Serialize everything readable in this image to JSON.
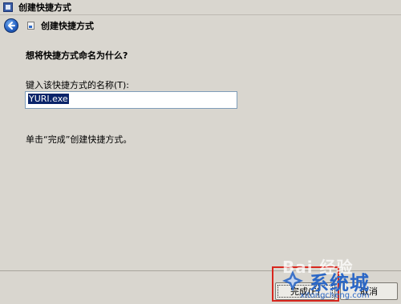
{
  "window": {
    "title": "创建快捷方式"
  },
  "header": {
    "title": "创建快捷方式"
  },
  "main": {
    "question": "想将快捷方式命名为什么?",
    "name_label": "键入该快捷方式的名称(T):",
    "name_value": "YURI.exe",
    "hint": "单击“完成”创建快捷方式。"
  },
  "footer": {
    "finish_label": "完成(F)",
    "cancel_label": "取消"
  },
  "watermark": {
    "baidu": "Bai 经验",
    "site_cn": "系统城",
    "site_url": "xitongcheng.com"
  },
  "colors": {
    "highlight_box": "#d8261d",
    "watermark_blue": "#2b67c6",
    "selection": "#0a246a"
  }
}
